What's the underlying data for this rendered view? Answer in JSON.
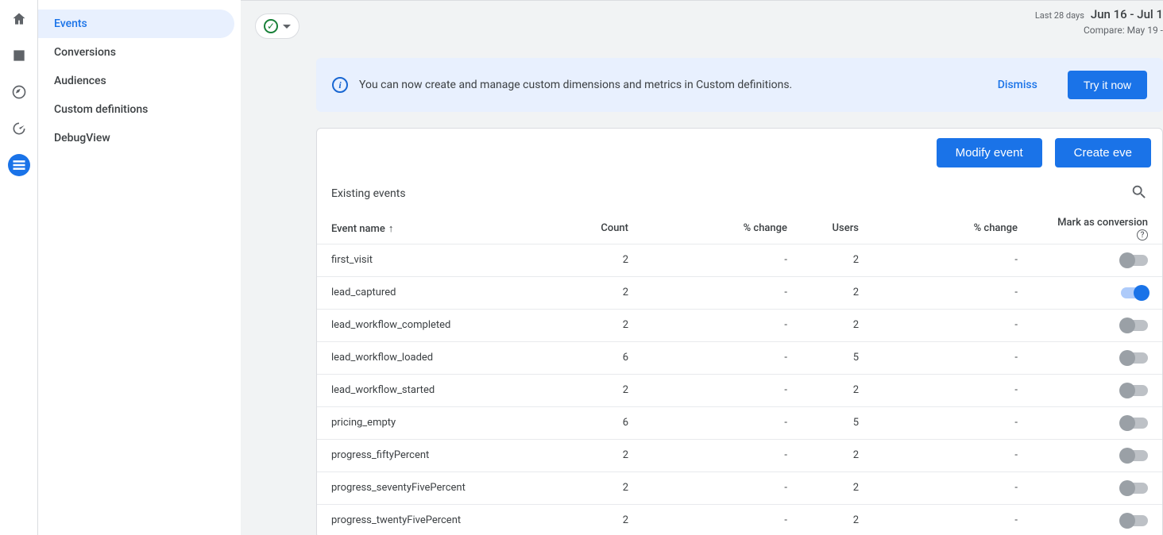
{
  "daterange": {
    "label": "Last 28 days",
    "range": "Jun 16 - Jul 1",
    "compare": "Compare: May 19 -"
  },
  "subnav": {
    "items": [
      {
        "label": "Events"
      },
      {
        "label": "Conversions"
      },
      {
        "label": "Audiences"
      },
      {
        "label": "Custom definitions"
      },
      {
        "label": "DebugView"
      }
    ]
  },
  "banner": {
    "message": "You can now create and manage custom dimensions and metrics in Custom definitions.",
    "dismiss": "Dismiss",
    "try": "Try it now"
  },
  "panel": {
    "modify_label": "Modify event",
    "create_label": "Create eve",
    "title": "Existing events",
    "columns": {
      "name": "Event name",
      "count": "Count",
      "change1": "% change",
      "users": "Users",
      "change2": "% change",
      "mark": "Mark as conversion"
    }
  },
  "events": [
    {
      "name": "first_visit",
      "count": "2",
      "change1": "-",
      "users": "2",
      "change2": "-",
      "conversion": false
    },
    {
      "name": "lead_captured",
      "count": "2",
      "change1": "-",
      "users": "2",
      "change2": "-",
      "conversion": true
    },
    {
      "name": "lead_workflow_completed",
      "count": "2",
      "change1": "-",
      "users": "2",
      "change2": "-",
      "conversion": false
    },
    {
      "name": "lead_workflow_loaded",
      "count": "6",
      "change1": "-",
      "users": "5",
      "change2": "-",
      "conversion": false
    },
    {
      "name": "lead_workflow_started",
      "count": "2",
      "change1": "-",
      "users": "2",
      "change2": "-",
      "conversion": false
    },
    {
      "name": "pricing_empty",
      "count": "6",
      "change1": "-",
      "users": "5",
      "change2": "-",
      "conversion": false
    },
    {
      "name": "progress_fiftyPercent",
      "count": "2",
      "change1": "-",
      "users": "2",
      "change2": "-",
      "conversion": false
    },
    {
      "name": "progress_seventyFivePercent",
      "count": "2",
      "change1": "-",
      "users": "2",
      "change2": "-",
      "conversion": false
    },
    {
      "name": "progress_twentyFivePercent",
      "count": "2",
      "change1": "-",
      "users": "2",
      "change2": "-",
      "conversion": false
    }
  ]
}
